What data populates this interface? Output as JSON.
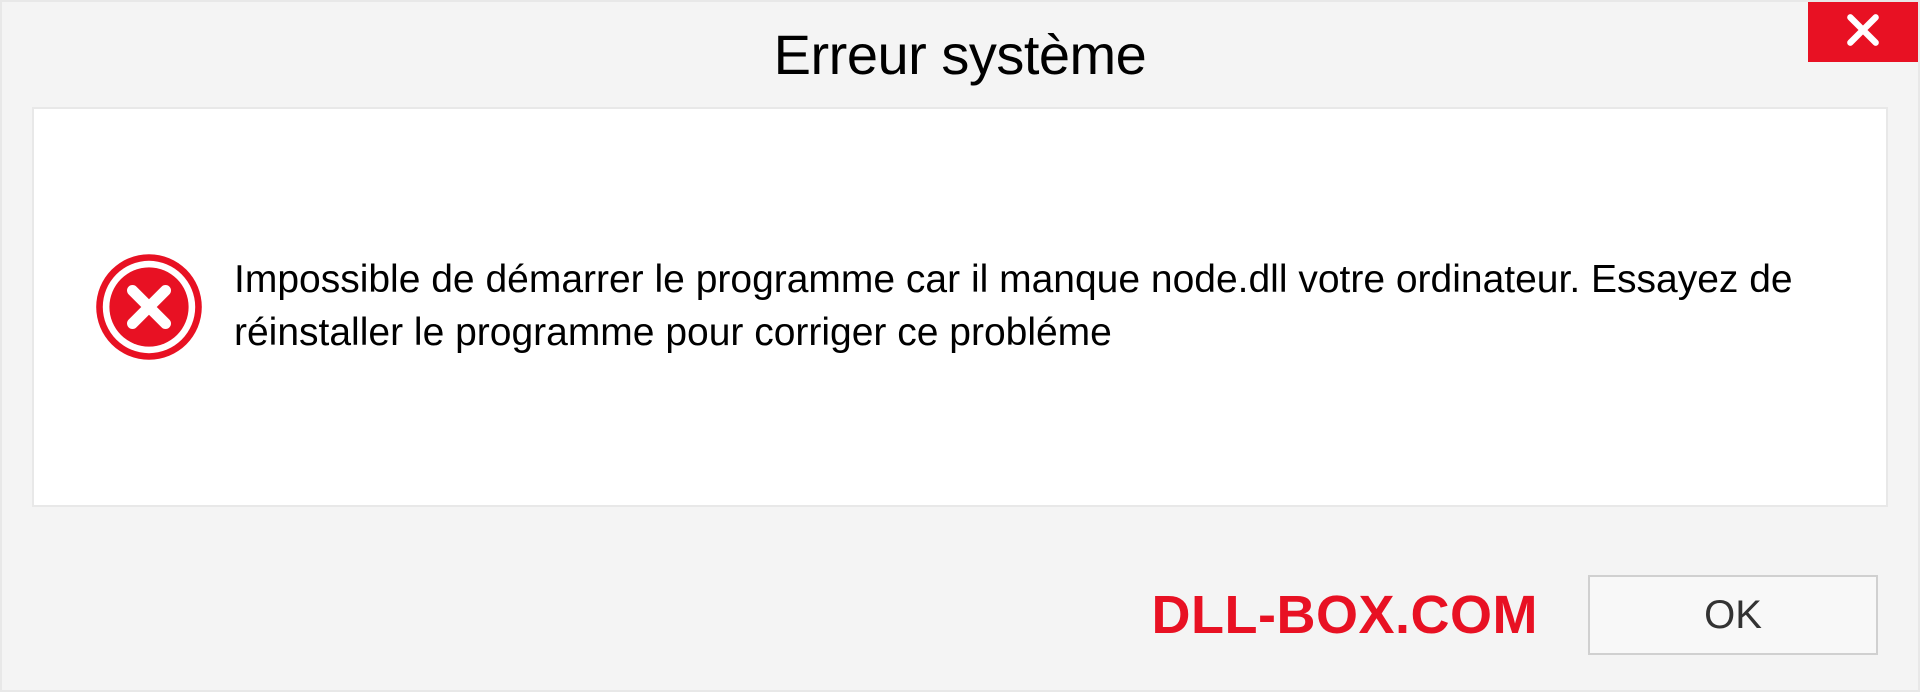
{
  "dialog": {
    "title": "Erreur système",
    "message": "Impossible de démarrer le programme car il manque node.dll votre ordinateur. Essayez de réinstaller le programme pour corriger ce probléme",
    "ok_label": "OK",
    "watermark": "DLL-BOX.COM"
  },
  "colors": {
    "error_red": "#e81123",
    "background": "#f4f4f4",
    "content_bg": "#ffffff"
  }
}
